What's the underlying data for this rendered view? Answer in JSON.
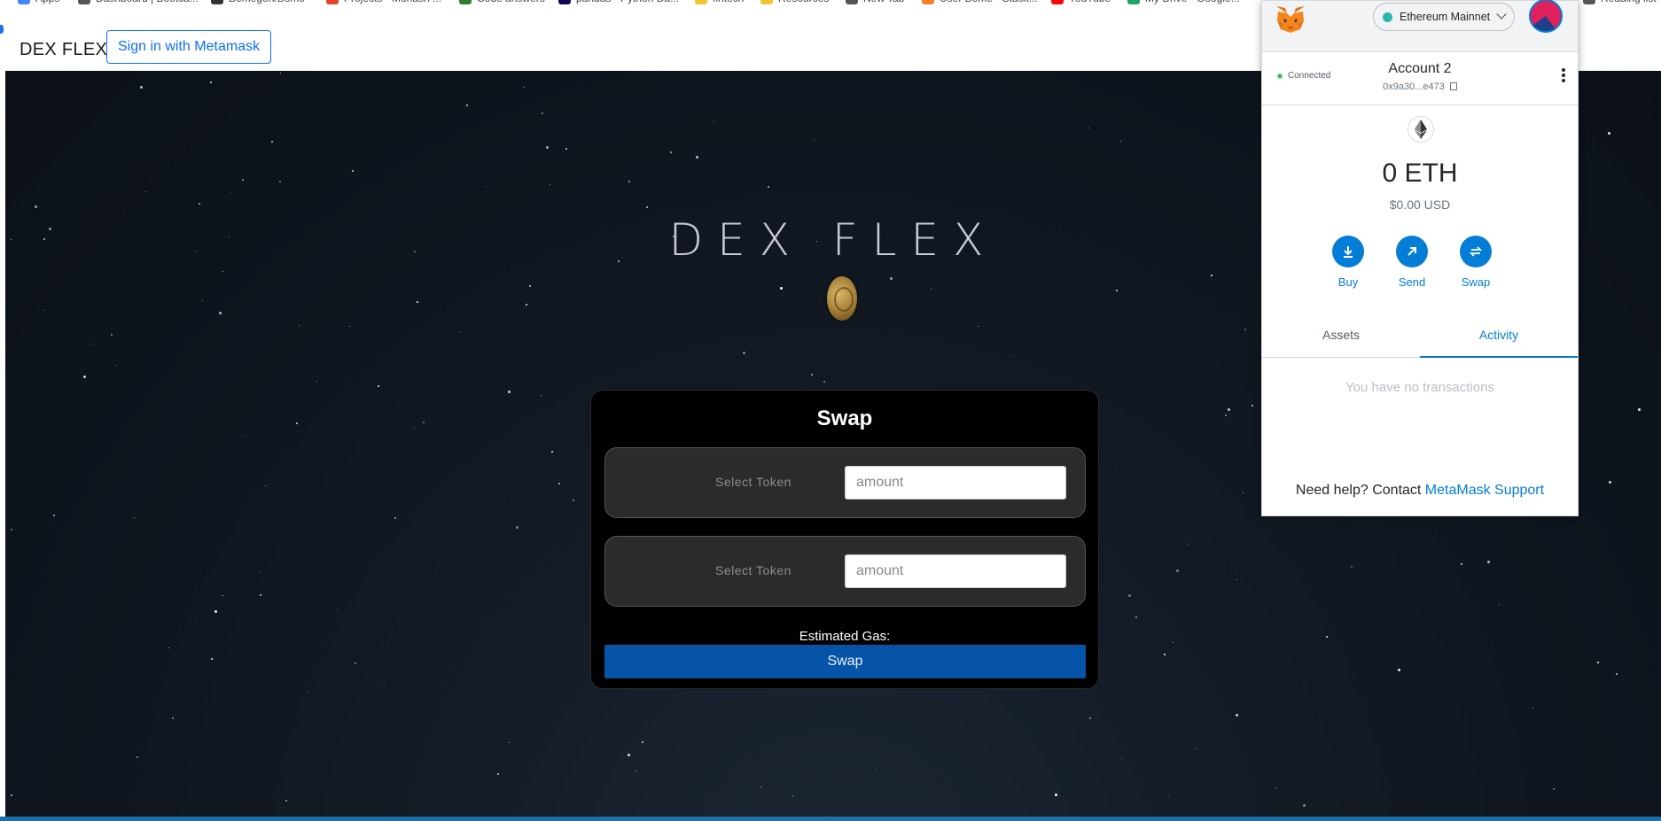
{
  "browser": {
    "bookmarks": [
      {
        "label": "Apps",
        "color": "#4285f4"
      },
      {
        "label": "Dashboard | Bootca...",
        "color": "#555555"
      },
      {
        "label": "Bomegoh/Bomc",
        "color": "#333333"
      },
      {
        "label": "Projects · Monash ...",
        "color": "#e24329"
      },
      {
        "label": "Code answers",
        "color": "#2e7d32"
      },
      {
        "label": "pandas - Python Da...",
        "color": "#150458"
      },
      {
        "label": "fintech",
        "color": "#f4c430"
      },
      {
        "label": "Resources",
        "color": "#f4c430"
      },
      {
        "label": "New Tab",
        "color": "#555555"
      },
      {
        "label": "User Bome - Stack...",
        "color": "#f48024"
      },
      {
        "label": "YouTube",
        "color": "#ff0000"
      },
      {
        "label": "My Drive - Google...",
        "color": "#1fa463"
      },
      {
        "label": "Reading list",
        "color": "#555555"
      }
    ]
  },
  "header": {
    "brand": "DEX FLEX",
    "signin_label": "Sign in with Metamask"
  },
  "hero": {
    "title": "DEX FLEX"
  },
  "swap": {
    "title": "Swap",
    "from": {
      "select_label": "Select Token",
      "amount_placeholder": "amount"
    },
    "to": {
      "select_label": "Select Token",
      "amount_placeholder": "amount"
    },
    "gas_label": "Estimated Gas:",
    "button_label": "Swap"
  },
  "metamask": {
    "network": "Ethereum Mainnet",
    "status": "Connected",
    "account_name": "Account 2",
    "account_address": "0x9a30...e473",
    "balance": "0 ETH",
    "balance_usd": "$0.00 USD",
    "actions": {
      "buy": "Buy",
      "send": "Send",
      "swap": "Swap"
    },
    "tabs": {
      "assets": "Assets",
      "activity": "Activity"
    },
    "active_tab": "Activity",
    "empty_text": "You have no transactions",
    "help_text": "Need help? Contact ",
    "help_link": "MetaMask Support",
    "accent_color": "#037dd6"
  }
}
